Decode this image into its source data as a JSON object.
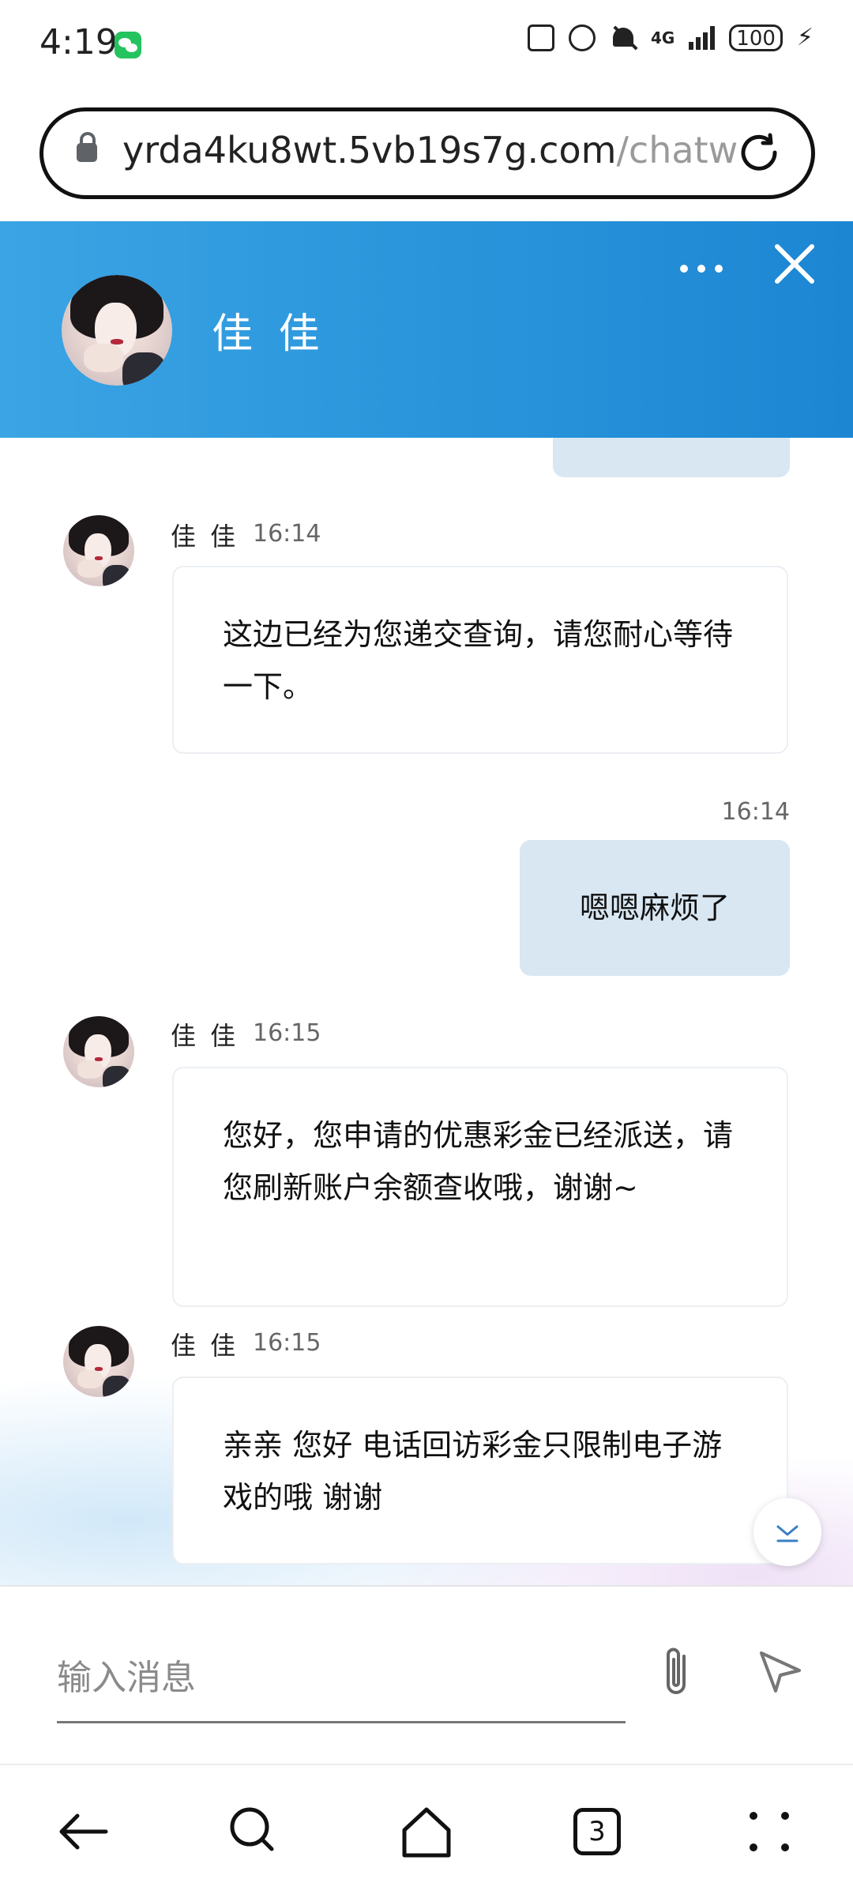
{
  "status_bar": {
    "time": "4:19",
    "network": "4G",
    "battery": "100"
  },
  "browser": {
    "url_domain": "yrda4ku8wt.5vb19s7g.com",
    "url_path": "/chatw",
    "tab_count": "3"
  },
  "chat": {
    "agent_name": "佳 佳"
  },
  "messages": [
    {
      "sender": "佳 佳",
      "time": "16:14",
      "text": "这边已经为您递交查询，请您耐心等待一下。"
    },
    {
      "sender": "me",
      "time": "16:14",
      "text": "嗯嗯麻烦了"
    },
    {
      "sender": "佳 佳",
      "time": "16:15",
      "text": "您好，您申请的优惠彩金已经派送，请您刷新账户余额查收哦，谢谢~"
    },
    {
      "sender": "佳 佳",
      "time": "16:15",
      "text": "亲亲 您好 电话回访彩金只限制电子游戏的哦 谢谢"
    }
  ],
  "composer": {
    "placeholder": "输入消息"
  },
  "colors": {
    "header": "#2196d9",
    "outgoing_bubble": "#d8e7f2",
    "incoming_bubble": "#ffffff"
  }
}
